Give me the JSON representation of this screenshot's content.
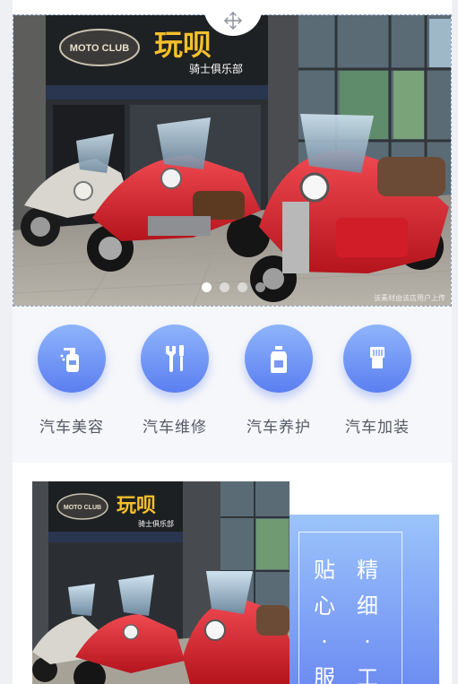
{
  "banner": {
    "sign_main": "玩呗",
    "sign_sub": "骑士俱乐部",
    "sign_logo": "MOTO CLUB",
    "watermark": "该素材由该店用户上传",
    "slide_count": 4,
    "active_slide": 1
  },
  "services": [
    {
      "label": "汽车美容",
      "icon": "spray-bottle-icon"
    },
    {
      "label": "汽车维修",
      "icon": "wrench-screwdriver-icon"
    },
    {
      "label": "汽车养护",
      "icon": "oil-can-icon"
    },
    {
      "label": "汽车加装",
      "icon": "brush-icon"
    }
  ],
  "feature": {
    "col1": [
      "精",
      "细",
      "·",
      "工"
    ],
    "col2": [
      "贴",
      "心",
      "·",
      "服"
    ]
  },
  "colors": {
    "accent_top": "#8fb4fb",
    "accent_bottom": "#5b7ff0",
    "moto_red": "#d8232f"
  }
}
